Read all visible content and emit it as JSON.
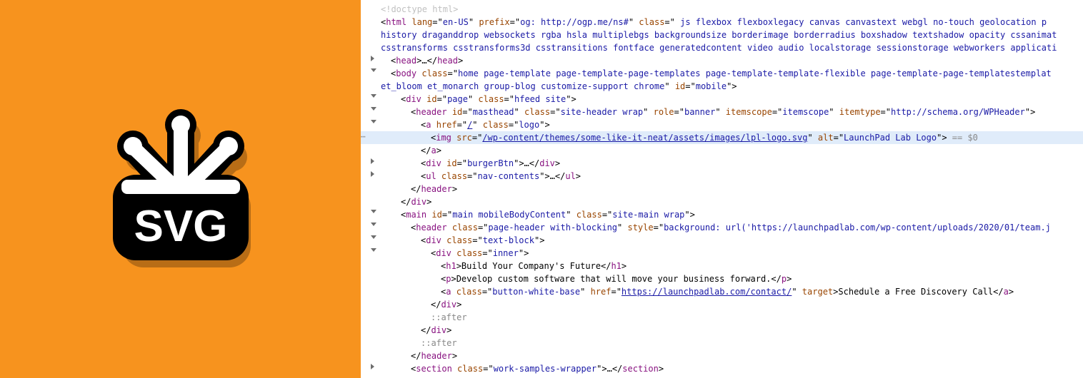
{
  "doctype": "<!doctype html>",
  "html": {
    "lang": "en-US",
    "prefix": "og: http://ogp.me/ns#",
    "class": " js flexbox flexboxlegacy canvas canvastext webgl no-touch geolocation p"
  },
  "html_cont1": "history draganddrop websockets rgba hsla multiplebgs backgroundsize borderimage borderradius boxshadow textshadow opacity cssanimat",
  "html_cont2": "csstransforms csstransforms3d csstransitions fontface generatedcontent video audio localstorage sessionstorage webworkers applicati",
  "head": {
    "open": "head",
    "ellipsis": "…",
    "close": "head"
  },
  "body": {
    "class": "home page-template page-template-page-templates page-template-template-flexible page-template-page-templatestemplat",
    "cont": "et_bloom et_monarch group-blog customize-support chrome",
    "id": "mobile"
  },
  "page_div": {
    "id": "page",
    "class": "hfeed site"
  },
  "header1": {
    "id": "masthead",
    "class": "site-header wrap",
    "role": "banner",
    "itemscope": "itemscope",
    "itemtype": "http://schema.org/WPHeader"
  },
  "logo_a": {
    "href": "/",
    "class": "logo"
  },
  "img": {
    "src": "/wp-content/themes/some-like-it-neat/assets/images/lpl-logo.svg",
    "alt": "LaunchPad Lab Logo",
    "trail": " == $0"
  },
  "burger": {
    "id": "burgerBtn"
  },
  "nav_ul": {
    "class": "nav-contents"
  },
  "main": {
    "id": "main mobileBodyContent",
    "class": "site-main wrap"
  },
  "header2": {
    "class": "page-header with-blocking",
    "style": "background: url('https://launchpadlab.com/wp-content/uploads/2020/01/team.j"
  },
  "textblock": {
    "class": "text-block"
  },
  "inner": {
    "class": "inner"
  },
  "h1": "Build Your Company's Future",
  "p": "Develop custom software that will move your business forward.",
  "cta": {
    "class": "button-white-base",
    "href": "https://launchpadlab.com/contact/",
    "target_attr": "target",
    "text": "Schedule a Free Discovery Call"
  },
  "after": "::after",
  "section": {
    "class": "work-samples-wrapper"
  },
  "ellipsis": "…"
}
